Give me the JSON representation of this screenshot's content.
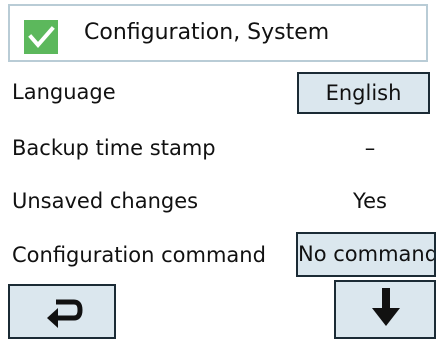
{
  "header": {
    "title": "Configuration, System",
    "status_icon": "checkmark-icon",
    "status_color": "#5cb85c"
  },
  "settings": [
    {
      "label": "Language",
      "value": "English",
      "editable": true
    },
    {
      "label": "Backup time stamp",
      "value": "–",
      "editable": false
    },
    {
      "label": "Unsaved changes",
      "value": "Yes",
      "editable": false
    },
    {
      "label": "Configuration command",
      "value": "No command",
      "editable": true
    }
  ],
  "nav": {
    "back_icon": "return-arrow-icon",
    "down_icon": "down-arrow-icon"
  },
  "colors": {
    "button_fill": "#dbe7ee",
    "button_border": "#1b2b35",
    "header_border": "#b9ccd6"
  }
}
